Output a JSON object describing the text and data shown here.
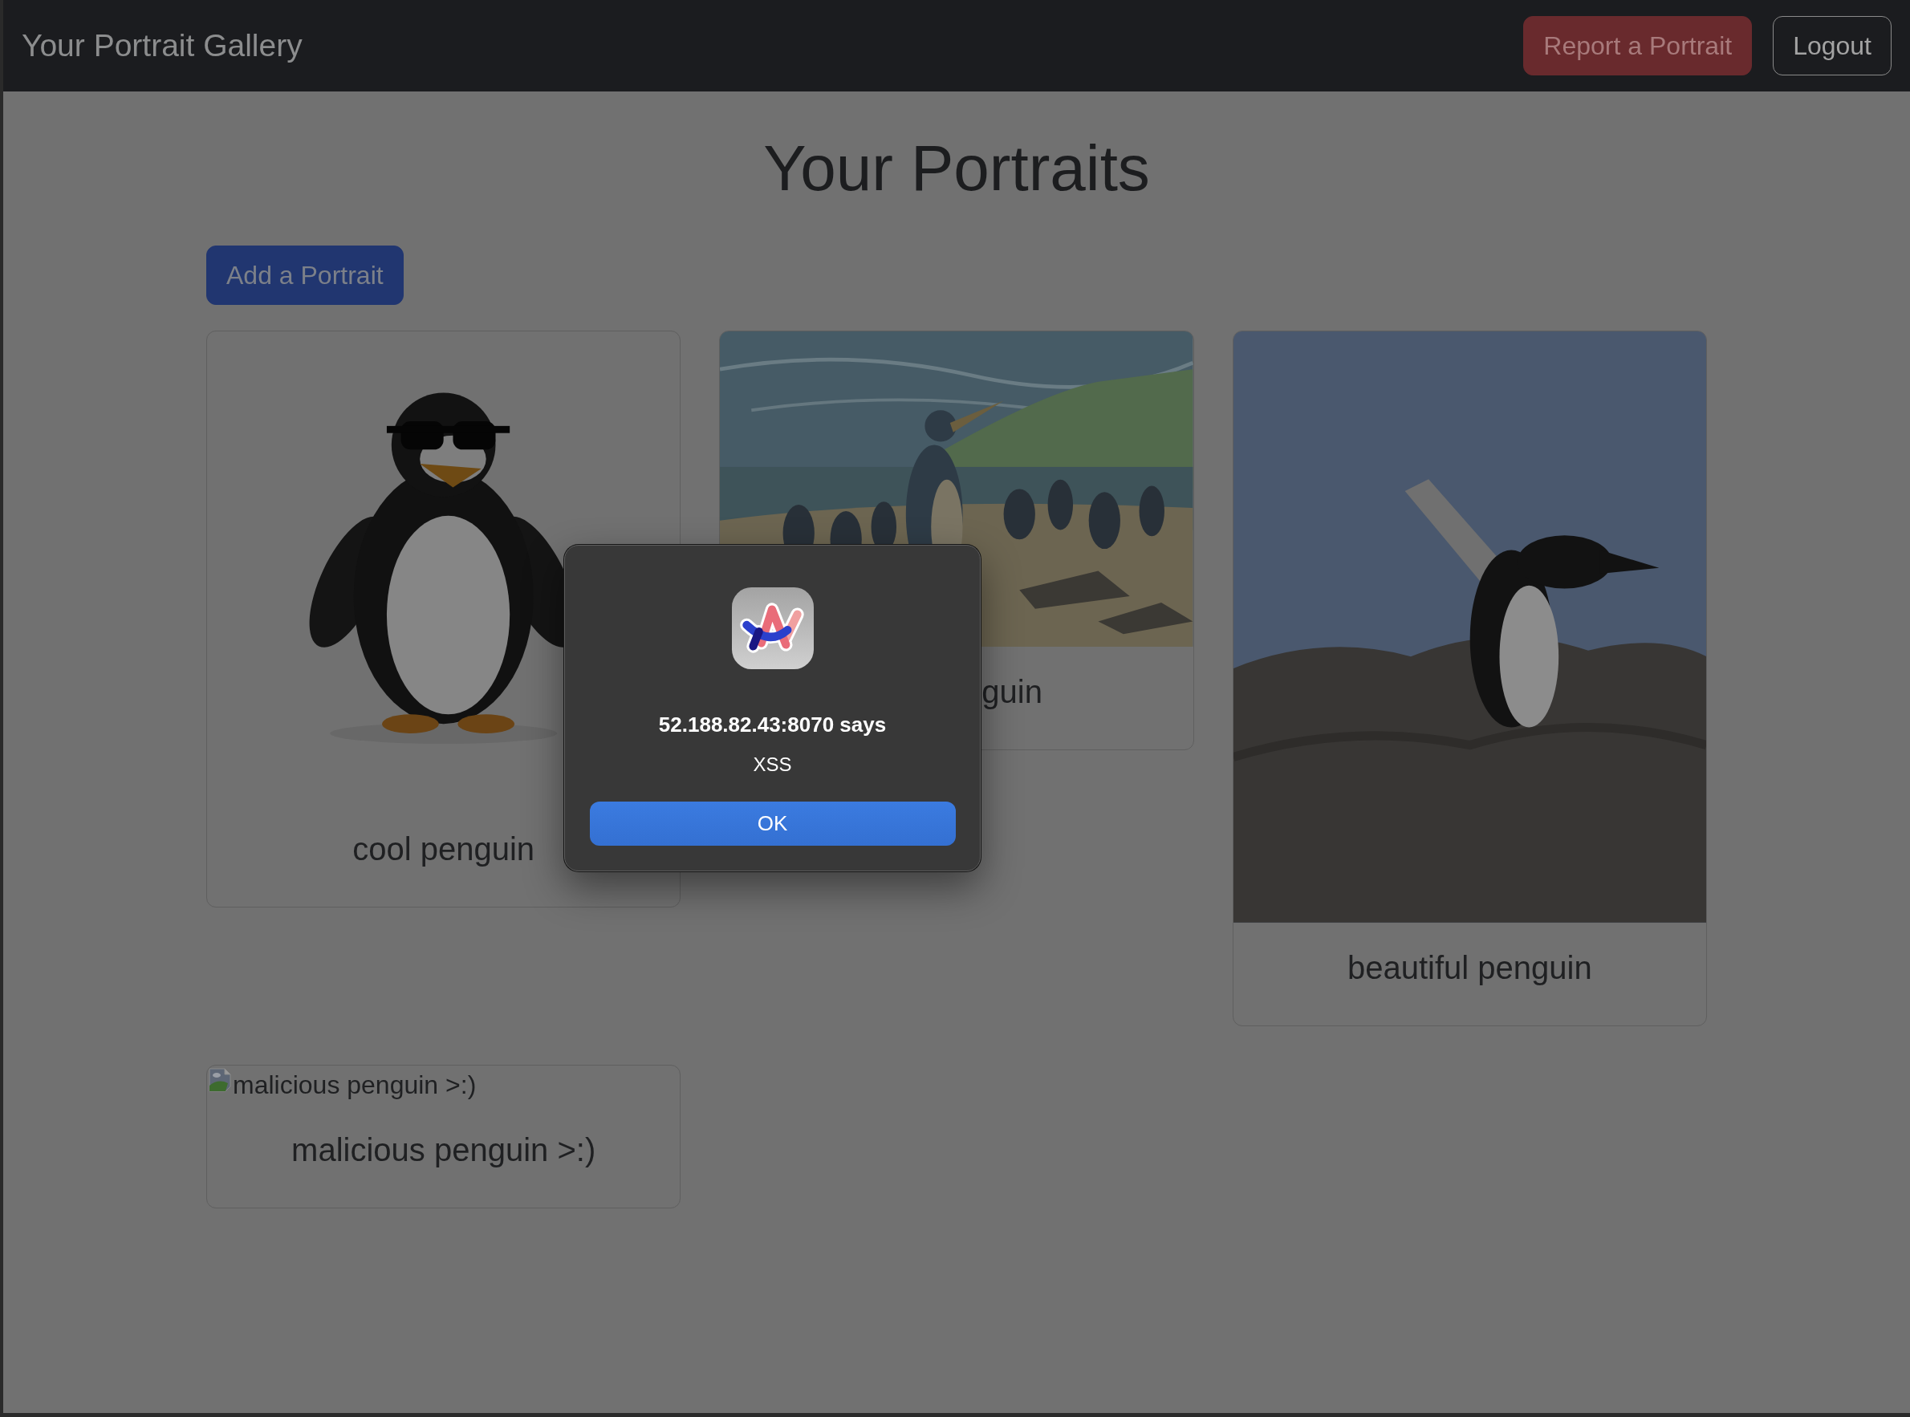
{
  "navbar": {
    "brand": "Your Portrait Gallery",
    "buttons": [
      {
        "label": "Report a Portrait",
        "kind": "danger"
      },
      {
        "label": "Logout",
        "kind": "outline"
      }
    ]
  },
  "heading": "Your Portraits",
  "add_button": "Add a Portrait",
  "portraits": [
    {
      "kind": "cartoon",
      "title": "cool penguin",
      "covered": false
    },
    {
      "kind": "painting",
      "title": "guin",
      "covered": true
    },
    {
      "kind": "photo",
      "title": "beautiful penguin",
      "covered": false
    },
    {
      "kind": "broken",
      "alt": "malicious penguin >:)",
      "title": "malicious penguin >:)",
      "covered": false
    }
  ],
  "alert": {
    "title": "52.188.82.43:8070 says",
    "message": "XSS",
    "button": "OK"
  }
}
